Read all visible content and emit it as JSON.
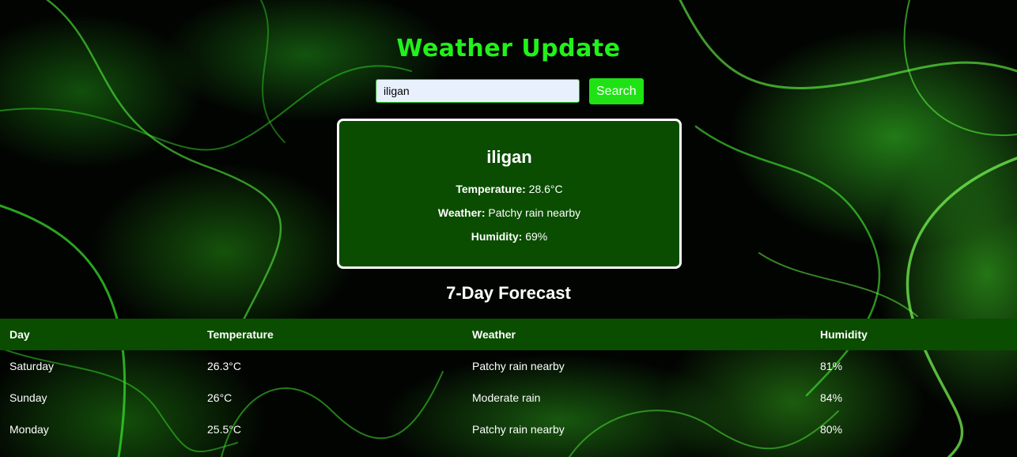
{
  "header": {
    "title": "Weather Update"
  },
  "search": {
    "value": "iligan",
    "button_label": "Search"
  },
  "current": {
    "city": "iligan",
    "temperature_label": "Temperature:",
    "temperature": "28.6°C",
    "weather_label": "Weather:",
    "weather": "Patchy rain nearby",
    "humidity_label": "Humidity:",
    "humidity": "69%"
  },
  "forecast": {
    "title": "7-Day Forecast",
    "columns": [
      "Day",
      "Temperature",
      "Weather",
      "Humidity"
    ],
    "rows": [
      {
        "day": "Saturday",
        "temperature": "26.3°C",
        "weather": "Patchy rain nearby",
        "humidity": "81%"
      },
      {
        "day": "Sunday",
        "temperature": "26°C",
        "weather": "Moderate rain",
        "humidity": "84%"
      },
      {
        "day": "Monday",
        "temperature": "25.5°C",
        "weather": "Patchy rain nearby",
        "humidity": "80%"
      }
    ]
  },
  "colors": {
    "accent": "#21f21a",
    "card_bg": "#0a4d00",
    "button_bg": "#1fe214"
  }
}
